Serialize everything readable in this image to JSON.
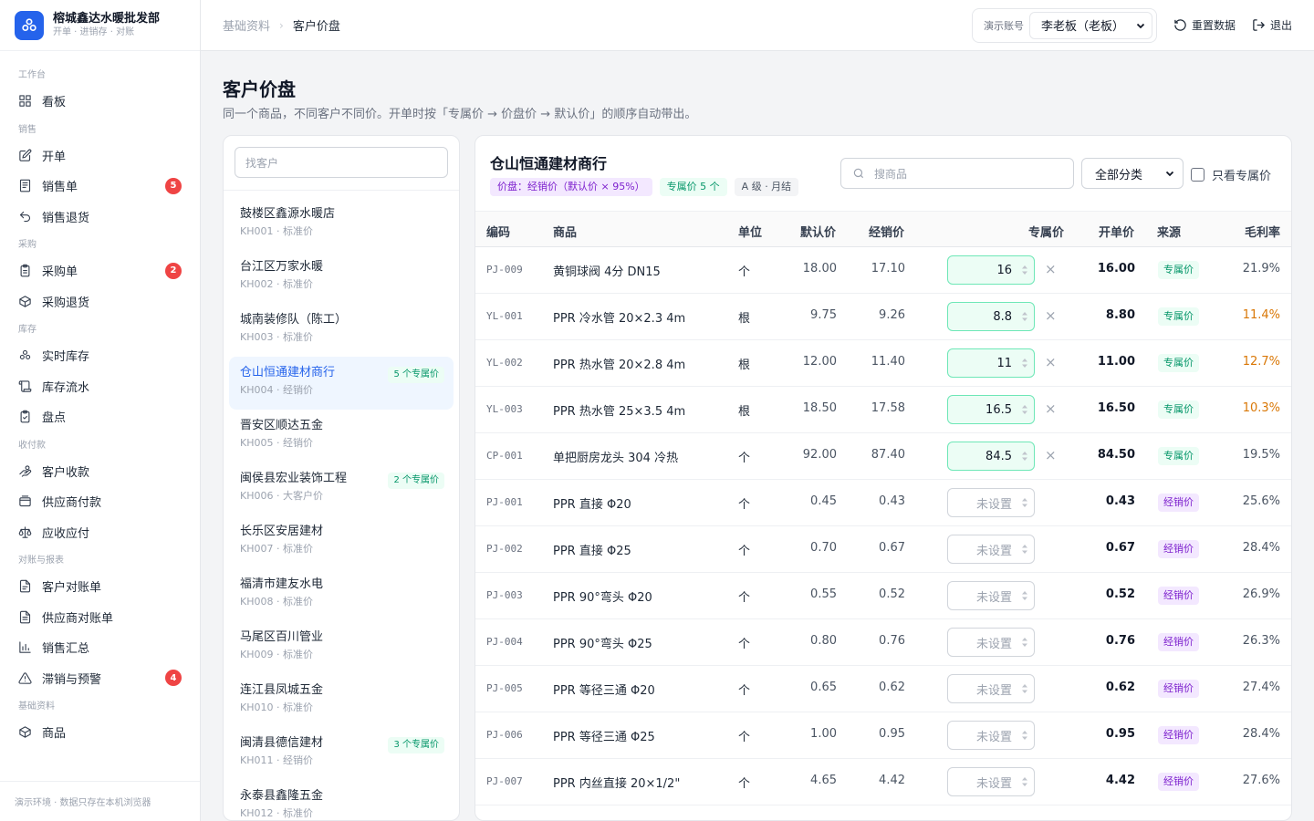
{
  "brand": {
    "name": "榕城鑫达水暖批发部",
    "sub": "开单 · 进销存 · 对账"
  },
  "nav": [
    {
      "group": "工作台",
      "items": [
        {
          "label": "看板",
          "icon": "dashboard-icon"
        }
      ]
    },
    {
      "group": "销售",
      "items": [
        {
          "label": "开单",
          "icon": "edit-icon"
        },
        {
          "label": "销售单",
          "icon": "receipt-icon",
          "badge": "5"
        },
        {
          "label": "销售退货",
          "icon": "undo-icon"
        }
      ]
    },
    {
      "group": "采购",
      "items": [
        {
          "label": "采购单",
          "icon": "clipboard-icon",
          "badge": "2"
        },
        {
          "label": "采购退货",
          "icon": "package-return-icon"
        }
      ]
    },
    {
      "group": "库存",
      "items": [
        {
          "label": "实时库存",
          "icon": "boxes-icon"
        },
        {
          "label": "库存流水",
          "icon": "scroll-icon"
        },
        {
          "label": "盘点",
          "icon": "clipboard-check-icon"
        }
      ]
    },
    {
      "group": "收付款",
      "items": [
        {
          "label": "客户收款",
          "icon": "hand-coins-icon"
        },
        {
          "label": "供应商付款",
          "icon": "wallet-icon"
        },
        {
          "label": "应收应付",
          "icon": "scale-icon"
        }
      ]
    },
    {
      "group": "对账与报表",
      "items": [
        {
          "label": "客户对账单",
          "icon": "file-text-icon"
        },
        {
          "label": "供应商对账单",
          "icon": "file-list-icon"
        },
        {
          "label": "销售汇总",
          "icon": "bar-chart-icon"
        },
        {
          "label": "滞销与预警",
          "icon": "warning-icon",
          "badge": "4"
        }
      ]
    },
    {
      "group": "基础资料",
      "items": [
        {
          "label": "商品",
          "icon": "box-icon"
        }
      ]
    }
  ],
  "footer_note": "演示环境 · 数据只存在本机浏览器",
  "breadcrumb": {
    "parent": "基础资料",
    "current": "客户价盘"
  },
  "account": {
    "label": "演示账号",
    "selected": "李老板（老板）"
  },
  "top_actions": {
    "reset": "重置数据",
    "logout": "退出"
  },
  "page": {
    "title": "客户价盘",
    "desc": "同一个商品，不同客户不同价。开单时按「专属价 → 价盘价 → 默认价」的顺序自动带出。"
  },
  "customer_search_placeholder": "找客户",
  "customers": [
    {
      "name": "鼓楼区鑫源水暖店",
      "meta": "KH001 · 标准价",
      "badge": ""
    },
    {
      "name": "台江区万家水暖",
      "meta": "KH002 · 标准价",
      "badge": ""
    },
    {
      "name": "城南装修队（陈工）",
      "meta": "KH003 · 标准价",
      "badge": ""
    },
    {
      "name": "仓山恒通建材商行",
      "meta": "KH004 · 经销价",
      "badge": "5 个专属价",
      "selected": true
    },
    {
      "name": "晋安区顺达五金",
      "meta": "KH005 · 经销价",
      "badge": ""
    },
    {
      "name": "闽侯县宏业装饰工程",
      "meta": "KH006 · 大客户价",
      "badge": "2 个专属价"
    },
    {
      "name": "长乐区安居建材",
      "meta": "KH007 · 标准价",
      "badge": ""
    },
    {
      "name": "福清市建友水电",
      "meta": "KH008 · 标准价",
      "badge": ""
    },
    {
      "name": "马尾区百川管业",
      "meta": "KH009 · 标准价",
      "badge": ""
    },
    {
      "name": "连江县凤城五金",
      "meta": "KH010 · 标准价",
      "badge": ""
    },
    {
      "name": "闽清县德信建材",
      "meta": "KH011 · 经销价",
      "badge": "3 个专属价"
    },
    {
      "name": "永泰县鑫隆五金",
      "meta": "KH012 · 标准价",
      "badge": ""
    }
  ],
  "detail": {
    "title": "仓山恒通建材商行",
    "tags": [
      "价盘：经销价（默认价 × 95%）",
      "专属价 5 个",
      "A 级 · 月结"
    ],
    "search_placeholder": "搜商品",
    "category": "全部分类",
    "only_mine": "只看专属价",
    "columns": [
      "编码",
      "商品",
      "单位",
      "默认价",
      "经销价",
      "专属价",
      "开单价",
      "来源",
      "毛利率"
    ],
    "unset_placeholder": "未设置",
    "rows": [
      {
        "code": "PJ-009",
        "name": "黄铜球阀 4分 DN15",
        "unit": "个",
        "default": "18.00",
        "dealer": "17.10",
        "exclusive": "16",
        "price": "16.00",
        "source": "专属价",
        "margin": "21.9%"
      },
      {
        "code": "YL-001",
        "name": "PPR 冷水管 20×2.3 4m",
        "unit": "根",
        "default": "9.75",
        "dealer": "9.26",
        "exclusive": "8.8",
        "price": "8.80",
        "source": "专属价",
        "margin": "11.4%",
        "warn": true
      },
      {
        "code": "YL-002",
        "name": "PPR 热水管 20×2.8 4m",
        "unit": "根",
        "default": "12.00",
        "dealer": "11.40",
        "exclusive": "11",
        "price": "11.00",
        "source": "专属价",
        "margin": "12.7%",
        "warn": true
      },
      {
        "code": "YL-003",
        "name": "PPR 热水管 25×3.5 4m",
        "unit": "根",
        "default": "18.50",
        "dealer": "17.58",
        "exclusive": "16.5",
        "price": "16.50",
        "source": "专属价",
        "margin": "10.3%",
        "warn": true
      },
      {
        "code": "CP-001",
        "name": "单把厨房龙头 304 冷热",
        "unit": "个",
        "default": "92.00",
        "dealer": "87.40",
        "exclusive": "84.5",
        "price": "84.50",
        "source": "专属价",
        "margin": "19.5%"
      },
      {
        "code": "PJ-001",
        "name": "PPR 直接 Φ20",
        "unit": "个",
        "default": "0.45",
        "dealer": "0.43",
        "exclusive": "",
        "price": "0.43",
        "source": "经销价",
        "margin": "25.6%"
      },
      {
        "code": "PJ-002",
        "name": "PPR 直接 Φ25",
        "unit": "个",
        "default": "0.70",
        "dealer": "0.67",
        "exclusive": "",
        "price": "0.67",
        "source": "经销价",
        "margin": "28.4%"
      },
      {
        "code": "PJ-003",
        "name": "PPR 90°弯头 Φ20",
        "unit": "个",
        "default": "0.55",
        "dealer": "0.52",
        "exclusive": "",
        "price": "0.52",
        "source": "经销价",
        "margin": "26.9%"
      },
      {
        "code": "PJ-004",
        "name": "PPR 90°弯头 Φ25",
        "unit": "个",
        "default": "0.80",
        "dealer": "0.76",
        "exclusive": "",
        "price": "0.76",
        "source": "经销价",
        "margin": "26.3%"
      },
      {
        "code": "PJ-005",
        "name": "PPR 等径三通 Φ20",
        "unit": "个",
        "default": "0.65",
        "dealer": "0.62",
        "exclusive": "",
        "price": "0.62",
        "source": "经销价",
        "margin": "27.4%"
      },
      {
        "code": "PJ-006",
        "name": "PPR 等径三通 Φ25",
        "unit": "个",
        "default": "1.00",
        "dealer": "0.95",
        "exclusive": "",
        "price": "0.95",
        "source": "经销价",
        "margin": "28.4%"
      },
      {
        "code": "PJ-007",
        "name": "PPR 内丝直接 20×1/2\"",
        "unit": "个",
        "default": "4.65",
        "dealer": "4.42",
        "exclusive": "",
        "price": "4.42",
        "source": "经销价",
        "margin": "27.6%"
      }
    ]
  }
}
